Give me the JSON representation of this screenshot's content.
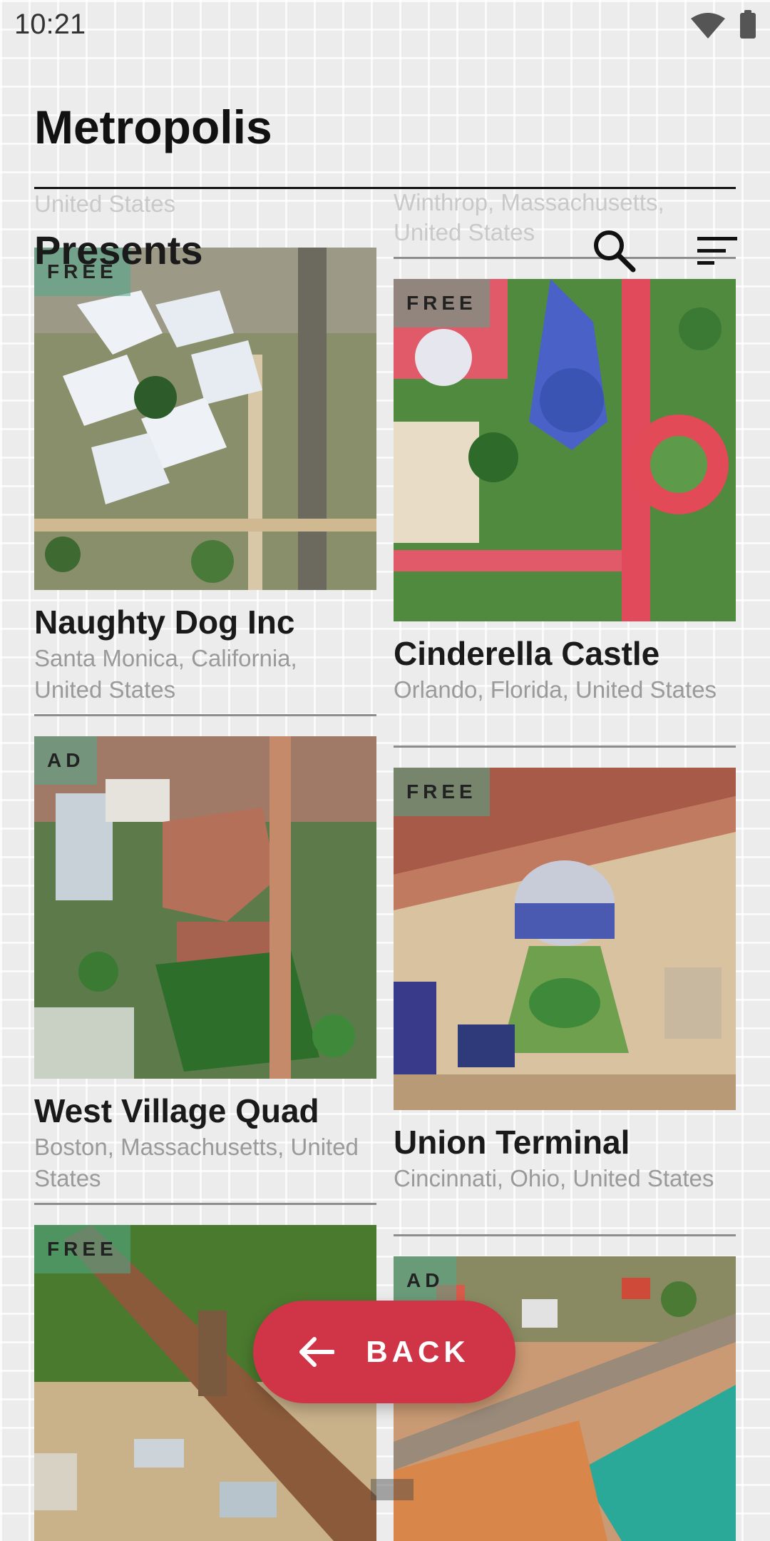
{
  "status_bar": {
    "time": "10:21"
  },
  "header": {
    "title": "Metropolis",
    "subtitle": "Presents"
  },
  "ghost": {
    "left": "United States",
    "right_line1": "Winthrop, Massachusetts,",
    "right_line2": "United States"
  },
  "cards": [
    {
      "badge": "FREE",
      "title": "Naughty Dog Inc",
      "location": "Santa Monica, California, United States"
    },
    {
      "badge": "FREE",
      "title": "Cinderella Castle",
      "location": "Orlando, Florida, United States"
    },
    {
      "badge": "AD",
      "title": "West Village Quad",
      "location": "Boston, Massachusetts, United States"
    },
    {
      "badge": "FREE",
      "title": "Union Terminal",
      "location": "Cincinnati, Ohio, United States"
    },
    {
      "badge": "FREE",
      "title": "",
      "location": ""
    },
    {
      "badge": "AD",
      "title": "",
      "location": ""
    }
  ],
  "back_button": {
    "label": "BACK"
  },
  "colors": {
    "accent": "#d03547",
    "badge_bg": "#50aa8c"
  }
}
